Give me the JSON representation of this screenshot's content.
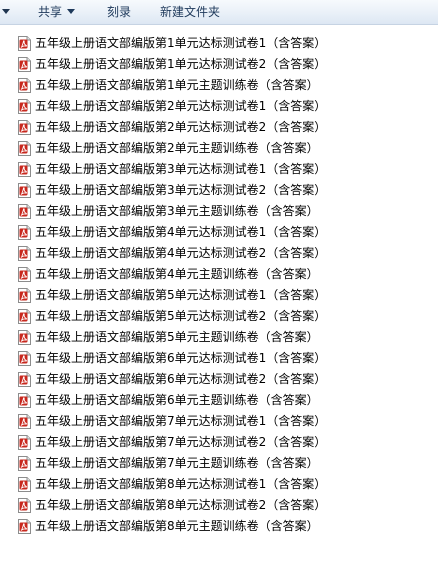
{
  "toolbar": {
    "share_label": "共享",
    "burn_label": "刻录",
    "new_folder_label": "新建文件夹"
  },
  "colors": {
    "toolbar_text": "#1e395b",
    "icon_red": "#c8281e",
    "background": "#ffffff"
  },
  "file_icon_name": "pdf-file-icon",
  "files": [
    {
      "name": "五年级上册语文部编版第1单元达标测试卷1（含答案）"
    },
    {
      "name": "五年级上册语文部编版第1单元达标测试卷2（含答案）"
    },
    {
      "name": "五年级上册语文部编版第1单元主题训练卷（含答案）"
    },
    {
      "name": "五年级上册语文部编版第2单元达标测试卷1（含答案）"
    },
    {
      "name": "五年级上册语文部编版第2单元达标测试卷2（含答案）"
    },
    {
      "name": "五年级上册语文部编版第2单元主题训练卷（含答案）"
    },
    {
      "name": "五年级上册语文部编版第3单元达标测试卷1（含答案）"
    },
    {
      "name": "五年级上册语文部编版第3单元达标测试卷2（含答案）"
    },
    {
      "name": "五年级上册语文部编版第3单元主题训练卷（含答案）"
    },
    {
      "name": "五年级上册语文部编版第4单元达标测试卷1（含答案）"
    },
    {
      "name": "五年级上册语文部编版第4单元达标测试卷2（含答案）"
    },
    {
      "name": "五年级上册语文部编版第4单元主题训练卷（含答案）"
    },
    {
      "name": "五年级上册语文部编版第5单元达标测试卷1（含答案）"
    },
    {
      "name": "五年级上册语文部编版第5单元达标测试卷2（含答案）"
    },
    {
      "name": "五年级上册语文部编版第5单元主题训练卷（含答案）"
    },
    {
      "name": "五年级上册语文部编版第6单元达标测试卷1（含答案）"
    },
    {
      "name": "五年级上册语文部编版第6单元达标测试卷2（含答案）"
    },
    {
      "name": "五年级上册语文部编版第6单元主题训练卷（含答案）"
    },
    {
      "name": "五年级上册语文部编版第7单元达标测试卷1（含答案）"
    },
    {
      "name": "五年级上册语文部编版第7单元达标测试卷2（含答案）"
    },
    {
      "name": "五年级上册语文部编版第7单元主题训练卷（含答案）"
    },
    {
      "name": "五年级上册语文部编版第8单元达标测试卷1（含答案）"
    },
    {
      "name": "五年级上册语文部编版第8单元达标测试卷2（含答案）"
    },
    {
      "name": "五年级上册语文部编版第8单元主题训练卷（含答案）"
    }
  ]
}
